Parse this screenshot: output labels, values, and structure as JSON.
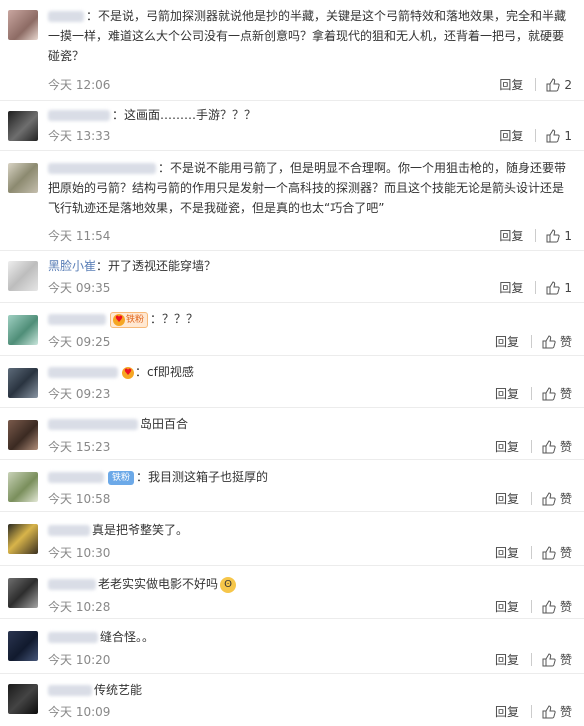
{
  "comments": [
    {
      "name_blur": true,
      "name": "",
      "badge": "",
      "text": "：不是说，弓箭加探测器就说他是抄的半藏，关键是这个弓箭特效和落地效果，完全和半藏一摸一样，难道这么大个公司没有一点新创意吗？拿着现代的狙和无人机，还背着一把弓，就硬要碰瓷？",
      "time": "今天 12:06",
      "reply": "回复",
      "like": "2"
    },
    {
      "name_blur": true,
      "name": "",
      "badge": "",
      "text": "：这画面………手游？？？",
      "time": "今天 13:33",
      "reply": "回复",
      "like": "1"
    },
    {
      "name_blur": true,
      "name": "",
      "badge": "",
      "text": "：不是说不能用弓箭了，但是明显不合理啊。你一个用狙击枪的，随身还要带把原始的弓箭？结构弓箭的作用只是发射一个高科技的探测器？而且这个技能无论是箭头设计还是飞行轨迹还是落地效果，不是我碰瓷，但是真的也太“巧合了吧”",
      "time": "今天 11:54",
      "reply": "回复",
      "like": "1"
    },
    {
      "name_blur": false,
      "name": "黑脸小崔",
      "badge": "",
      "text": "：开了透视还能穿墙？",
      "time": "今天 09:35",
      "reply": "回复",
      "like": "1"
    },
    {
      "name_blur": true,
      "name": "",
      "badge": "铁粉",
      "text": "：？？？",
      "time": "今天 09:25",
      "reply": "回复",
      "like": "赞"
    },
    {
      "name_blur": true,
      "name": "",
      "badge": "heart",
      "text": "：cf即视感",
      "time": "今天 09:23",
      "reply": "回复",
      "like": "赞"
    },
    {
      "name_blur": true,
      "name": "",
      "badge": "",
      "text": "岛田百合",
      "time": "今天 15:23",
      "reply": "回复",
      "like": "赞"
    },
    {
      "name_blur": true,
      "name": "",
      "badge": "铁粉",
      "badge_style": "blue",
      "text": "：我目测这箱子也挺厚的",
      "time": "今天 10:58",
      "reply": "回复",
      "like": "赞"
    },
    {
      "name_blur": true,
      "name": "",
      "badge": "",
      "text": "真是把爷整笑了。",
      "time": "今天 10:30",
      "reply": "回复",
      "like": "赞"
    },
    {
      "name_blur": true,
      "name": "",
      "badge": "",
      "text": "老老实实做电影不好吗",
      "emoji": true,
      "time": "今天 10:28",
      "reply": "回复",
      "like": "赞"
    },
    {
      "name_blur": true,
      "name": "",
      "badge": "",
      "text": "缝合怪。。",
      "time": "今天 10:20",
      "reply": "回复",
      "like": "赞"
    },
    {
      "name_blur": true,
      "name": "",
      "badge": "",
      "text": "传统艺能",
      "time": "今天 10:09",
      "reply": "回复",
      "like": "赞"
    }
  ],
  "colors": {
    "name": "#5b7fb7",
    "time": "#888888",
    "border": "#ececec"
  }
}
